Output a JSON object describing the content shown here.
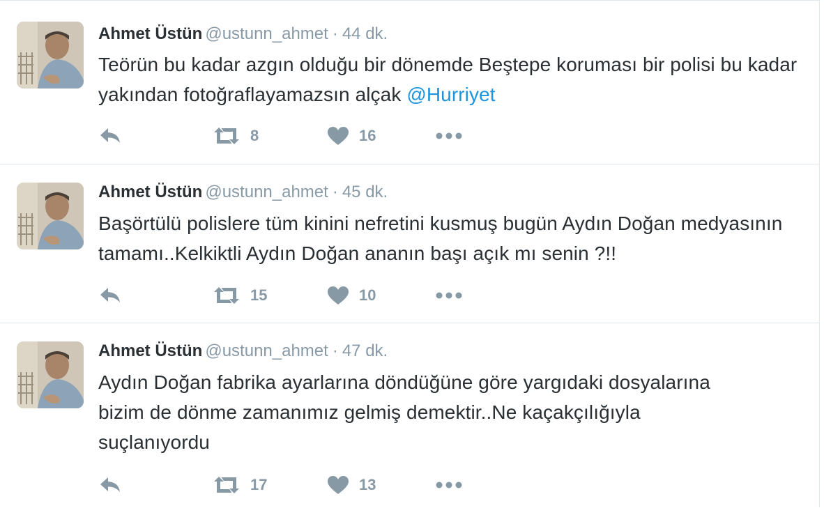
{
  "colors": {
    "text": "#292f33",
    "secondary": "#8899a6",
    "link": "#1b95e0",
    "divider": "#e1e8ed",
    "icon": "#8899a6"
  },
  "icons": {
    "reply": "reply-icon",
    "retweet": "retweet-icon",
    "like": "heart-icon",
    "more": "more-icon"
  },
  "tweets": [
    {
      "name": "Ahmet Üstün",
      "handle": "@ustunn_ahmet",
      "separator": "·",
      "time": "44 dk.",
      "text": "Teörün bu kadar azgın olduğu bir dönemde Beştepe koruması bir polisi bu kadar yakından fotoğraflayamazsın alçak ",
      "mention": "@Hurriyet",
      "retweets": "8",
      "likes": "16"
    },
    {
      "name": "Ahmet Üstün",
      "handle": "@ustunn_ahmet",
      "separator": "·",
      "time": "45 dk.",
      "text": "Başörtülü polislere tüm kinini nefretini kusmuş bugün Aydın Doğan medyasının tamamı..Kelkiktli Aydın Doğan ananın başı açık mı senin ?!!",
      "mention": "",
      "retweets": "15",
      "likes": "10"
    },
    {
      "name": "Ahmet Üstün",
      "handle": "@ustunn_ahmet",
      "separator": "·",
      "time": "47 dk.",
      "text": "Aydın Doğan fabrika ayarlarına döndüğüne göre yargıdaki dosyalarına bizim de dönme zamanımız gelmiş demektir..Ne kaçakçılığıyla suçlanıyordu",
      "mention": "",
      "retweets": "17",
      "likes": "13"
    }
  ]
}
